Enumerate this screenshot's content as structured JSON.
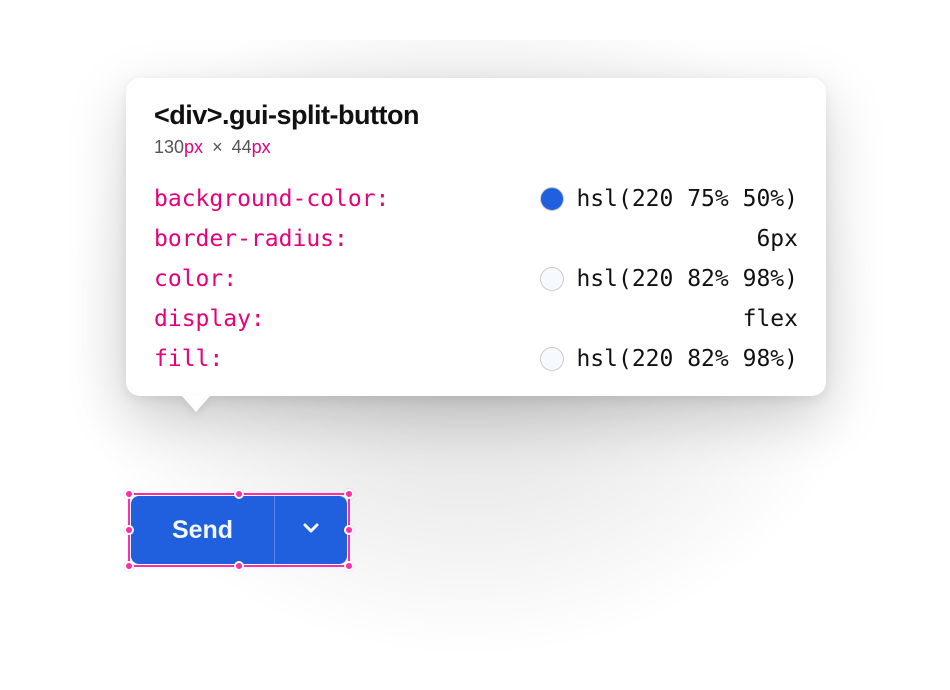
{
  "tooltip": {
    "selector": "<div>.gui-split-button",
    "dimensions": {
      "w_num": "130",
      "w_unit": "px",
      "times": "×",
      "h_num": "44",
      "h_unit": "px"
    },
    "props": [
      {
        "name": "background-color:",
        "swatch": "#2060df",
        "value": "hsl(220 75% 50%)"
      },
      {
        "name": "border-radius:",
        "swatch": null,
        "value": "6px"
      },
      {
        "name": "color:",
        "swatch": "#f6f9fe",
        "value": "hsl(220 82% 98%)"
      },
      {
        "name": "display:",
        "swatch": null,
        "value": "flex"
      },
      {
        "name": "fill:",
        "swatch": "#f6f9fe",
        "value": "hsl(220 82% 98%)"
      }
    ]
  },
  "button": {
    "label": "Send",
    "background": "#2060df",
    "color": "#f6f9fe"
  }
}
